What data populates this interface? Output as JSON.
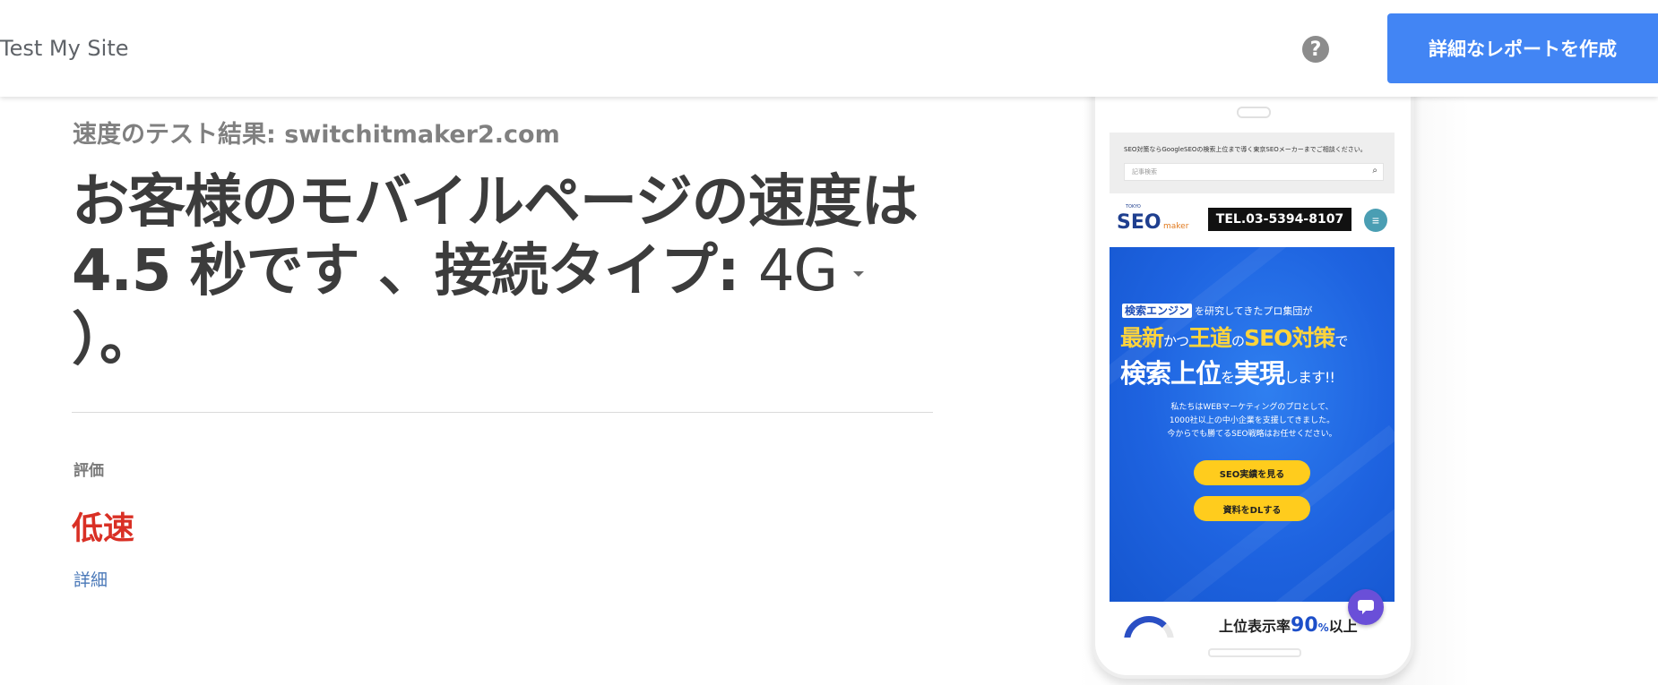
{
  "header": {
    "brand": "Test My Site",
    "help_icon": "help-circle-icon",
    "help_glyph": "?",
    "report_button": "詳細なレポートを作成"
  },
  "result": {
    "subtitle": "速度のテスト結果: switchitmaker2.com",
    "headline_main": "お客様のモバイルページの速度は 4.5 秒です 、接続タイプ: ",
    "connection_type": "4G",
    "headline_end": "）。",
    "evaluation_label": "評価",
    "rating": "低速",
    "details_link": "詳細"
  },
  "colors": {
    "accent": "#4285f4",
    "rating": "#d93025",
    "link": "#4a78b8"
  },
  "preview": {
    "notice": "SEO対策ならGoogleSEOの検索上位まで導く東京SEOメーカーまでご相談ください。",
    "search_placeholder": "記事検索",
    "search_icon": "magnifier-icon",
    "logo_text": "SEO",
    "logo_sub": "maker",
    "logo_small": "TOKYO",
    "tel": "TEL.03-5394-8107",
    "menu_icon": "menu-circle-icon",
    "hero": {
      "tag1": "検索エンジン",
      "line1_rest": "を研究してきたプロ集団が",
      "line2_a": "最新",
      "line2_b": "かつ",
      "line2_c": "王道",
      "line2_d": "の",
      "line2_e": "SEO対策",
      "line2_f": "で",
      "line3_a": "検索上位",
      "line3_b": "を",
      "line3_c": "実現",
      "line3_d": "します!!",
      "desc1": "私たちはWEBマーケティングのプロとして、",
      "desc2": "1000社以上の中小企業を支援してきました。",
      "desc3": "今からでも勝てるSEO戦略はお任せください。",
      "button1": "SEO実績を見る",
      "button2": "資料をDLする"
    },
    "rank": {
      "prefix": "上位表示率",
      "value": "90",
      "unit": "%",
      "suffix": "以上"
    },
    "chat_icon": "chat-bubble-icon"
  }
}
